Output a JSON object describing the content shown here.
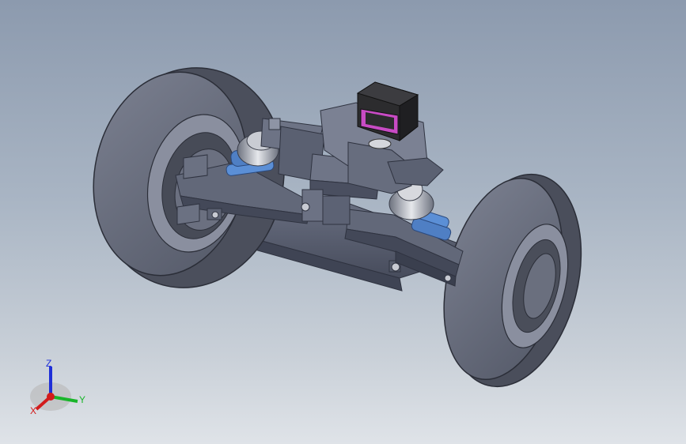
{
  "viewport": {
    "background_top": "#8c9aae",
    "background_bottom": "#dfe3e8"
  },
  "model": {
    "part_color": "#5f6577",
    "part_light": "#8a90a1",
    "part_dark": "#3f4455",
    "tire_color": "#6a6f7e",
    "spring_color": "#5b8fd6",
    "servo_body": "#2c2c2e",
    "servo_label": "#c84bc4"
  },
  "triad": {
    "z_label": "Z",
    "y_label": "Y",
    "x_label": "X",
    "z_color": "#1f2fd8",
    "y_color": "#19b52a",
    "x_color": "#d21b1b"
  }
}
